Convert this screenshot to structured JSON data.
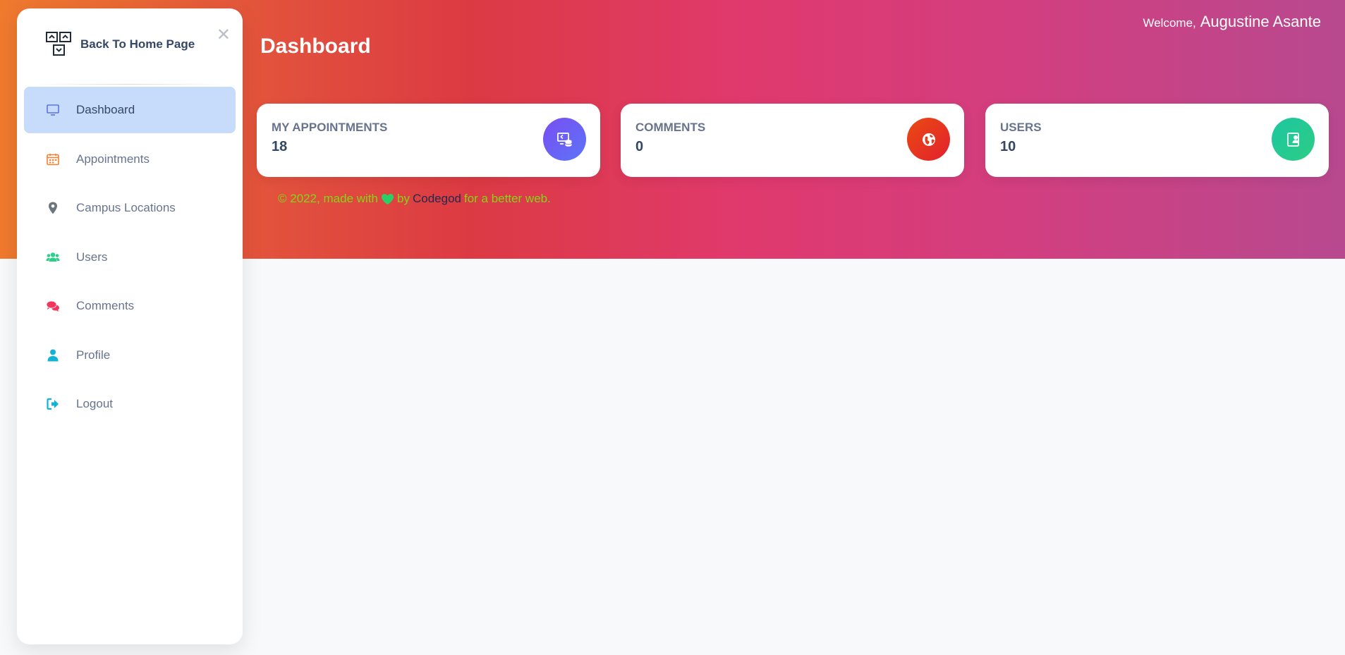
{
  "sidebar": {
    "brand_label": "Back To Home Page",
    "items": [
      {
        "label": "Dashboard",
        "icon": "monitor-icon",
        "active": true
      },
      {
        "label": "Appointments",
        "icon": "calendar-icon"
      },
      {
        "label": "Campus Locations",
        "icon": "map-pin-icon"
      },
      {
        "label": "Users",
        "icon": "users-icon"
      },
      {
        "label": "Comments",
        "icon": "comments-icon"
      },
      {
        "label": "Profile",
        "icon": "user-icon"
      },
      {
        "label": "Logout",
        "icon": "logout-icon"
      }
    ]
  },
  "header": {
    "title": "Dashboard",
    "welcome_prefix": "Welcome,",
    "user_name": "Augustine Asante"
  },
  "cards": [
    {
      "title": "MY APPOINTMENTS",
      "value": "18",
      "icon": "screen-database-icon",
      "color": "#6b5cf2"
    },
    {
      "title": "COMMENTS",
      "value": "0",
      "icon": "globe-icon",
      "color": "#e83b1e"
    },
    {
      "title": "USERS",
      "value": "10",
      "icon": "user-card-icon",
      "color": "#1fc79b"
    }
  ],
  "footer": {
    "prefix": "© 2022, made with",
    "by": "by",
    "link": "Codegod",
    "suffix": "for a better web."
  }
}
